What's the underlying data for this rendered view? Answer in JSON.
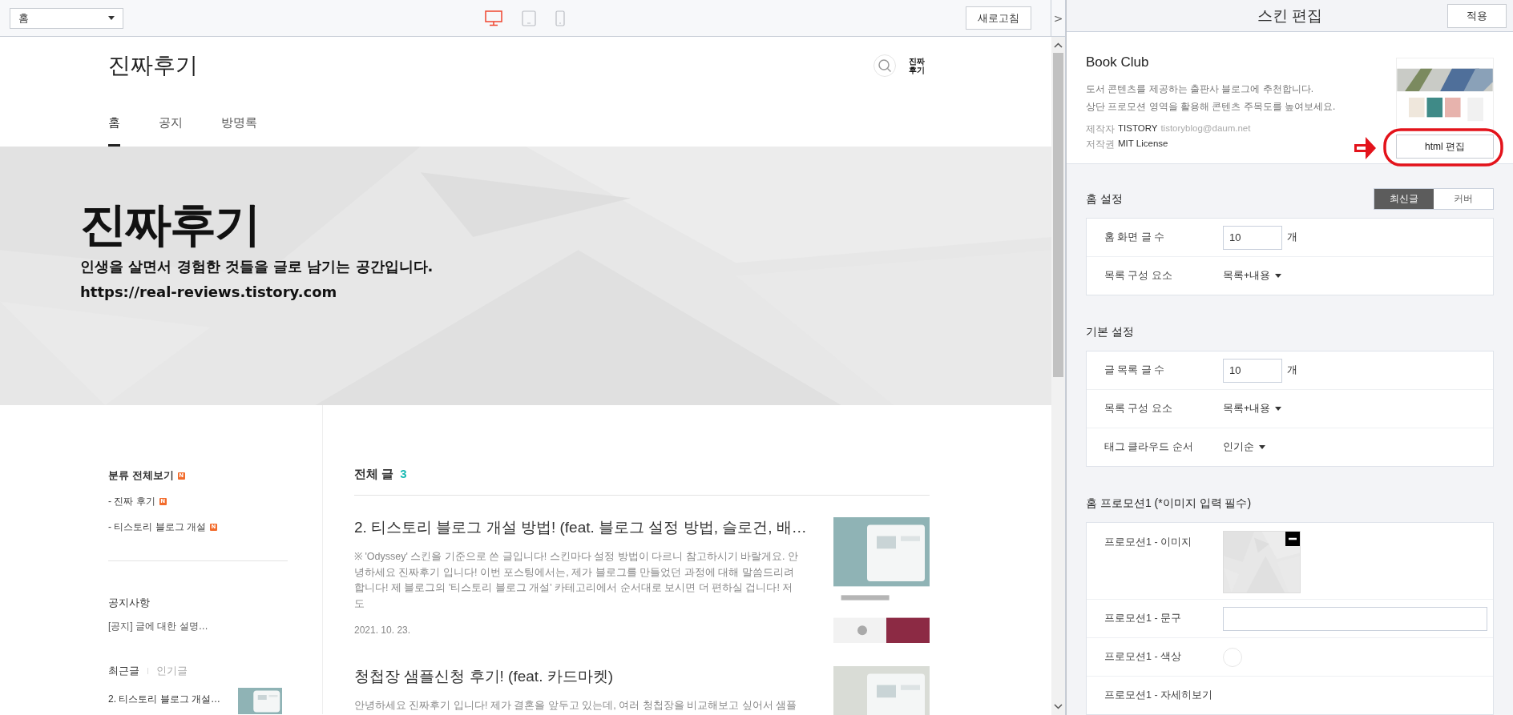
{
  "toolbar": {
    "page_select": "홈",
    "devices": [
      {
        "kind": "desktop",
        "selected": true
      },
      {
        "kind": "tablet",
        "selected": false
      },
      {
        "kind": "mobile",
        "selected": false
      }
    ],
    "refresh_button": "새로고침",
    "collapse_button": ">"
  },
  "preview": {
    "blog_title": "진짜후기",
    "logo_lines": [
      "진짜",
      "후기"
    ],
    "nav": [
      {
        "label": "홈",
        "selected": true
      },
      {
        "label": "공지",
        "selected": false
      },
      {
        "label": "방명록",
        "selected": false
      }
    ],
    "hero": {
      "kind": "picture",
      "title": "진짜후기",
      "tagline": "인생을 살면서 경험한 것들을 글로 남기는 공간입니다.",
      "url": "https://real-reviews.tistory.com"
    },
    "sidebar": {
      "category_heading": {
        "label": "분류 전체보기",
        "badge": "N"
      },
      "categories": [
        {
          "label": "- 진짜 후기",
          "badge": "N"
        },
        {
          "label": "- 티스토리 블로그 개설",
          "badge": "N"
        }
      ],
      "notice_heading": "공지사항",
      "notices": [
        "[공지] 글에 대한 설명…"
      ],
      "recent_tabs": [
        {
          "label": "최근글",
          "selected": true
        },
        {
          "label": "인기글",
          "selected": false
        }
      ],
      "recent_posts": [
        {
          "title": "2. 티스토리 블로그 개설…",
          "kind": "picture"
        }
      ]
    },
    "main": {
      "heading": "전체 글",
      "count": "3",
      "posts": [
        {
          "title": "2. 티스토리 블로그 개설 방법! (feat. 블로그 설정 방법, 슬로건, 배…",
          "excerpt": "※ 'Odyssey' 스킨을 기준으로 쓴 글입니다! 스킨마다 설정 방법이 다르니 참고하시기 바랄게요. 안녕하세요 진짜후기 입니다! 이번 포스팅에서는, 제가 블로그를 만들었던 과정에 대해 말씀드리려 합니다! 제 블로그의 '티스토리 블로그 개설' 카테고리에서 순서대로 보시면 더 편하실 겁니다! 저도",
          "date": "2021. 10. 23."
        },
        {
          "title": "청첩장 샘플신청 후기! (feat. 카드마켓)",
          "excerpt": "안녕하세요 진짜후기 입니다! 제가 결혼을 앞두고 있는데, 여러 청첩장을 비교해보고 싶어서 샘플"
        }
      ]
    }
  },
  "panel": {
    "title": "스킨 편집",
    "apply_button": "적용",
    "skin": {
      "name": "Book Club",
      "description": [
        "도서 콘텐츠를 제공하는 출판사 블로그에 추천합니다.",
        "상단 프로모션 영역을 활용해 콘텐츠 주목도를 높여보세요."
      ],
      "author_label": "제작자",
      "author": "TISTORY",
      "author_email": "tistoryblog@daum.net",
      "license_label": "저작권",
      "license": "MIT License",
      "edit_button": "html 편집",
      "highlighted": true
    },
    "sections": [
      {
        "title": "홈 설정",
        "toggle": [
          {
            "label": "최신글",
            "selected": true
          },
          {
            "label": "커버",
            "selected": false
          }
        ],
        "rows": [
          {
            "kind": "number",
            "label": "홈 화면 글 수",
            "value": "10",
            "unit": "개"
          },
          {
            "kind": "select",
            "label": "목록 구성 요소",
            "value": "목록+내용"
          }
        ]
      },
      {
        "title": "기본 설정",
        "rows": [
          {
            "kind": "number",
            "label": "글 목록 글 수",
            "value": "10",
            "unit": "개"
          },
          {
            "kind": "select",
            "label": "목록 구성 요소",
            "value": "목록+내용"
          },
          {
            "kind": "select",
            "label": "태그 클라우드 순서",
            "value": "인기순"
          }
        ]
      },
      {
        "title": "홈 프로모션1 (*이미지 입력 필수)",
        "rows": [
          {
            "label": "프로모션1 - 이미지"
          },
          {
            "kind": "text",
            "label": "프로모션1 - 문구"
          },
          {
            "kind": "color",
            "label": "프로모션1 - 색상"
          },
          {
            "kind": "plain",
            "label": "프로모션1 - 자세히보기"
          }
        ]
      }
    ]
  }
}
